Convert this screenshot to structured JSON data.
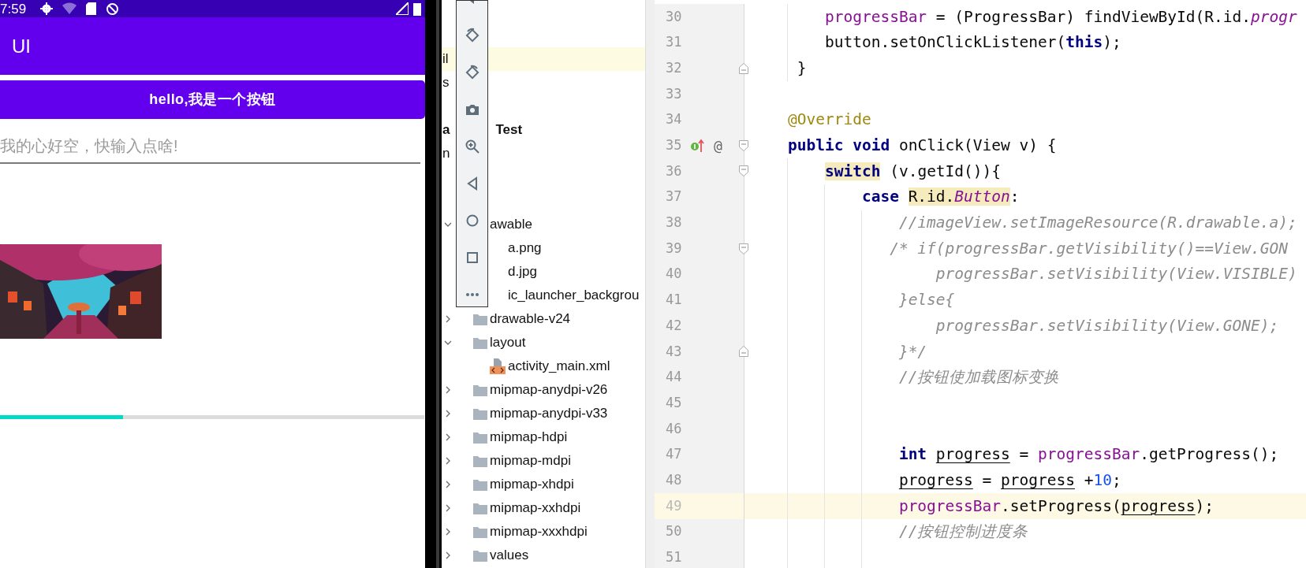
{
  "phone": {
    "status_bar": {
      "time": "7:59"
    },
    "app_bar": {
      "title": "UI"
    },
    "button": {
      "label": "hello,我是一个按钮"
    },
    "input": {
      "placeholder": "我的心好空，快输入点啥!"
    },
    "progress": {
      "level": 0.29
    }
  },
  "project_tree": {
    "items": [
      {
        "kind": "fragment",
        "text": "il",
        "highlighted": true
      },
      {
        "kind": "fragment",
        "text": "s",
        "highlighted": false
      },
      {
        "kind": "covered"
      },
      {
        "kind": "module",
        "prefix": "a",
        "text": "Test"
      },
      {
        "kind": "fragment",
        "text": "n",
        "highlighted": false
      },
      {
        "kind": "covered"
      },
      {
        "kind": "covered"
      },
      {
        "kind": "folder",
        "text": "awable",
        "expanded": true,
        "covered": true,
        "children": [
          {
            "kind": "file",
            "text": "a.png",
            "covered": true
          },
          {
            "kind": "file",
            "text": "d.jpg",
            "covered": true
          },
          {
            "kind": "file",
            "text": "ic_launcher_backgrou",
            "covered": true
          }
        ]
      },
      {
        "kind": "folder",
        "text": "drawable-v24",
        "expanded": false,
        "covered": false
      },
      {
        "kind": "folder",
        "text": "layout",
        "expanded": true,
        "covered": false,
        "children": [
          {
            "kind": "xml",
            "text": "activity_main.xml",
            "covered": false
          }
        ]
      },
      {
        "kind": "folder",
        "text": "mipmap-anydpi-v26",
        "expanded": false,
        "covered": false
      },
      {
        "kind": "folder",
        "text": "mipmap-anydpi-v33",
        "expanded": false,
        "covered": false
      },
      {
        "kind": "folder",
        "text": "mipmap-hdpi",
        "expanded": false,
        "covered": false
      },
      {
        "kind": "folder",
        "text": "mipmap-mdpi",
        "expanded": false,
        "covered": false
      },
      {
        "kind": "folder",
        "text": "mipmap-xhdpi",
        "expanded": false,
        "covered": false
      },
      {
        "kind": "folder",
        "text": "mipmap-xxhdpi",
        "expanded": false,
        "covered": false
      },
      {
        "kind": "folder",
        "text": "mipmap-xxxhdpi",
        "expanded": false,
        "covered": false
      },
      {
        "kind": "folder",
        "text": "values",
        "expanded": false,
        "covered": false
      }
    ]
  },
  "editor": {
    "lines": [
      {
        "number": "30",
        "tokens": [
          {
            "t": "    progressBar",
            "kind": "field"
          },
          {
            "t": " = (ProgressBar) findViewById(R.id.",
            "kind": "plain"
          },
          {
            "t": "progr",
            "kind": "static"
          }
        ]
      },
      {
        "number": "31",
        "tokens": [
          {
            "t": "    button.setOnClickListener(",
            "kind": "plain"
          },
          {
            "t": "this",
            "kind": "keyword"
          },
          {
            "t": ");",
            "kind": "plain"
          }
        ]
      },
      {
        "number": "32",
        "fold": {
          "kind": "end"
        },
        "tokens": [
          {
            "t": " }",
            "kind": "plain"
          }
        ]
      },
      {
        "number": "33"
      },
      {
        "number": "34",
        "tokens": [
          {
            "t": "@Override",
            "kind": "annotation"
          }
        ]
      },
      {
        "number": "35",
        "fold": {
          "kind": "start"
        },
        "implements": true,
        "gutter_mark": "@",
        "tokens": [
          {
            "t": "public",
            "kind": "keyword"
          },
          {
            "t": " void",
            "kind": "keyword"
          },
          {
            "t": " onClick(View v) {",
            "kind": "plain"
          }
        ]
      },
      {
        "number": "36",
        "fold": {
          "kind": "start"
        },
        "tokens": [
          {
            "t": "    switch",
            "kind": "keyword",
            "hl": true
          },
          {
            "t": " (v.getId()){",
            "kind": "plain"
          }
        ]
      },
      {
        "number": "37",
        "tokens": [
          {
            "t": "        case ",
            "kind": "keyword"
          },
          {
            "t": "R.id.",
            "kind": "plain",
            "hl": true
          },
          {
            "t": "Button",
            "kind": "static",
            "hl": true
          },
          {
            "t": ":",
            "kind": "plain"
          }
        ]
      },
      {
        "number": "38",
        "tokens": [
          {
            "t": "            //imageView.setImageResource(R.drawable.a);",
            "kind": "comment"
          }
        ]
      },
      {
        "number": "39",
        "fold": {
          "kind": "start"
        },
        "tokens": [
          {
            "t": "           /* if(progressBar.getVisibility()==View.GON",
            "kind": "comment"
          }
        ]
      },
      {
        "number": "40",
        "tokens": [
          {
            "t": "                progressBar.setVisibility(View.VISIBLE)",
            "kind": "comment"
          }
        ]
      },
      {
        "number": "41",
        "tokens": [
          {
            "t": "            }else{",
            "kind": "comment"
          }
        ]
      },
      {
        "number": "42",
        "tokens": [
          {
            "t": "                progressBar.setVisibility(View.GONE);",
            "kind": "comment"
          }
        ]
      },
      {
        "number": "43",
        "fold": {
          "kind": "end"
        },
        "tokens": [
          {
            "t": "            }*/",
            "kind": "comment"
          }
        ]
      },
      {
        "number": "44",
        "tokens": [
          {
            "t": "            //按钮使加载图标变换",
            "kind": "comment"
          }
        ]
      },
      {
        "number": "45"
      },
      {
        "number": "46"
      },
      {
        "number": "47",
        "tokens": [
          {
            "t": "            int ",
            "kind": "keyword"
          },
          {
            "t": "progress",
            "kind": "var"
          },
          {
            "t": " = ",
            "kind": "plain"
          },
          {
            "t": "progressBar",
            "kind": "field"
          },
          {
            "t": ".getProgress();",
            "kind": "plain"
          }
        ]
      },
      {
        "number": "48",
        "tokens": [
          {
            "t": "            progress",
            "kind": "var"
          },
          {
            "t": " = ",
            "kind": "plain"
          },
          {
            "t": "progress",
            "kind": "var"
          },
          {
            "t": " +",
            "kind": "plain"
          },
          {
            "t": "10",
            "kind": "number"
          },
          {
            "t": ";",
            "kind": "plain"
          }
        ]
      },
      {
        "number": "49",
        "current": true,
        "tokens": [
          {
            "t": "            progressBar",
            "kind": "field"
          },
          {
            "t": ".setProgress(",
            "kind": "plain"
          },
          {
            "t": "progress",
            "kind": "var"
          },
          {
            "t": ");",
            "kind": "plain"
          }
        ]
      },
      {
        "number": "50",
        "tokens": [
          {
            "t": "            //按钮控制进度条",
            "kind": "comment"
          }
        ]
      },
      {
        "number": "51"
      }
    ]
  }
}
